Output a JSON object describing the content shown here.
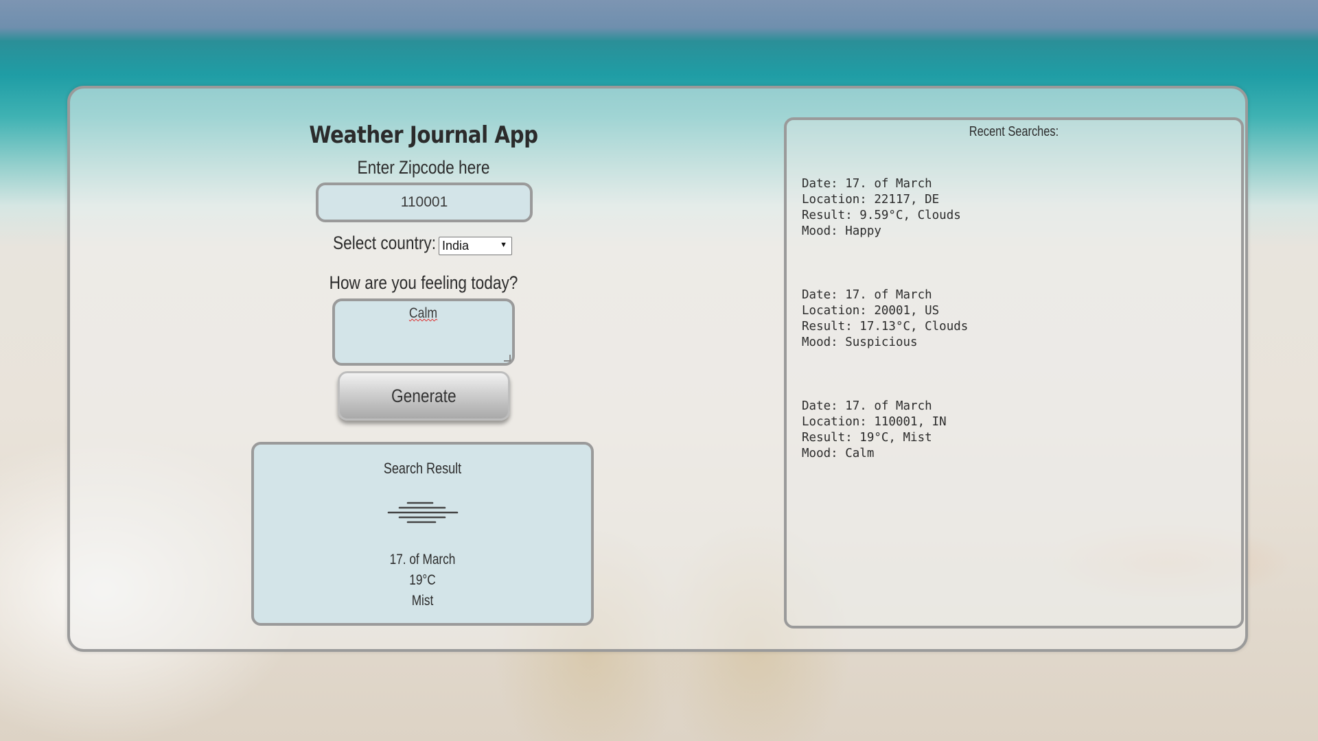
{
  "app": {
    "title": "Weather Journal App"
  },
  "zipcode": {
    "label": "Enter Zipcode here",
    "value": "110001"
  },
  "country": {
    "label": "Select country:",
    "selected": "India"
  },
  "mood": {
    "label": "How are you feeling today?",
    "value": "Calm"
  },
  "generate": {
    "label": "Generate"
  },
  "result": {
    "title": "Search Result",
    "icon": "mist-icon",
    "date": "17. of March",
    "temp": "19°C",
    "description": "Mist"
  },
  "recent": {
    "title": "Recent Searches:",
    "entries": [
      {
        "date_line": "Date: 17. of March",
        "location_line": "Location: 22117, DE",
        "result_line": "Result: 9.59°C, Clouds",
        "mood_line": "Mood: Happy"
      },
      {
        "date_line": "Date: 17. of March",
        "location_line": "Location: 20001, US",
        "result_line": "Result: 17.13°C, Clouds",
        "mood_line": "Mood: Suspicious"
      },
      {
        "date_line": "Date: 17. of March",
        "location_line": "Location: 110001, IN",
        "result_line": "Result: 19°C, Mist",
        "mood_line": "Mood: Calm"
      }
    ]
  },
  "colors": {
    "panel_border": "#9a9a9a",
    "input_bg": "#d3e4e8",
    "text": "#2b2b2b"
  }
}
